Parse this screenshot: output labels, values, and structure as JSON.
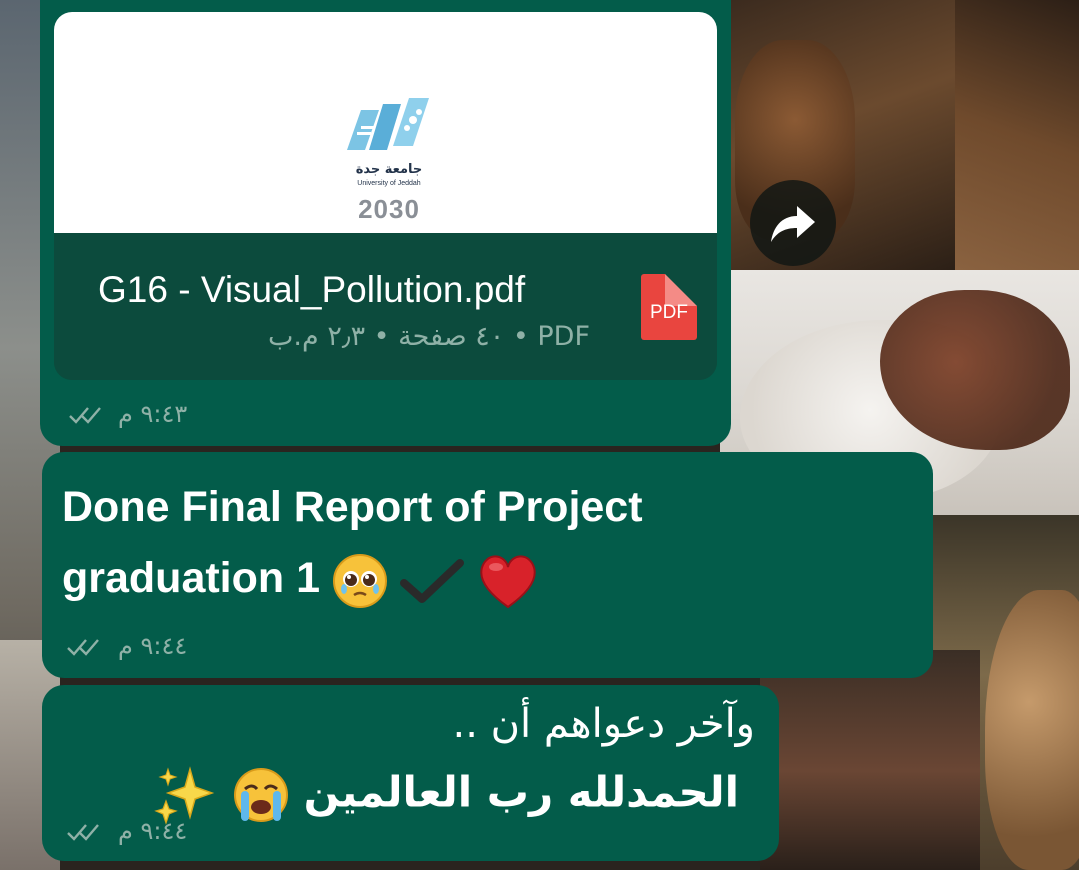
{
  "pdf_message": {
    "preview": {
      "logo_arabic": "جامعة جدة",
      "logo_english": "University of Jeddah",
      "logo_2030": "2030"
    },
    "filename": "G16 - Visual_Pollution.pdf",
    "meta": "٤٠ صفحة • ٢٫٣ م.ب • PDF",
    "badge_label": "PDF",
    "time": "٩:٤٣ م",
    "status_icon": "double-check-icon"
  },
  "forward_button": {
    "icon": "forward-arrow-icon"
  },
  "message_1": {
    "line1": "Done Final Report of Project",
    "line2": "graduation 1",
    "emojis": [
      "pleading-face-icon",
      "check-mark-icon",
      "red-heart-icon"
    ],
    "time": "٩:٤٤ م",
    "status_icon": "double-check-icon"
  },
  "message_2": {
    "line1": "وآخر دعواهم أن ..",
    "line2": "الحمدلله رب العالمين",
    "emojis": [
      "loudly-crying-face-icon",
      "sparkles-icon"
    ],
    "time": "٩:٤٤ م",
    "status_icon": "double-check-icon"
  },
  "colors": {
    "bubble": "#035c4a",
    "pdf_info": "#0c4b3d",
    "meta_text": "#8fb1a7",
    "pdf_badge": "#e9453f"
  }
}
